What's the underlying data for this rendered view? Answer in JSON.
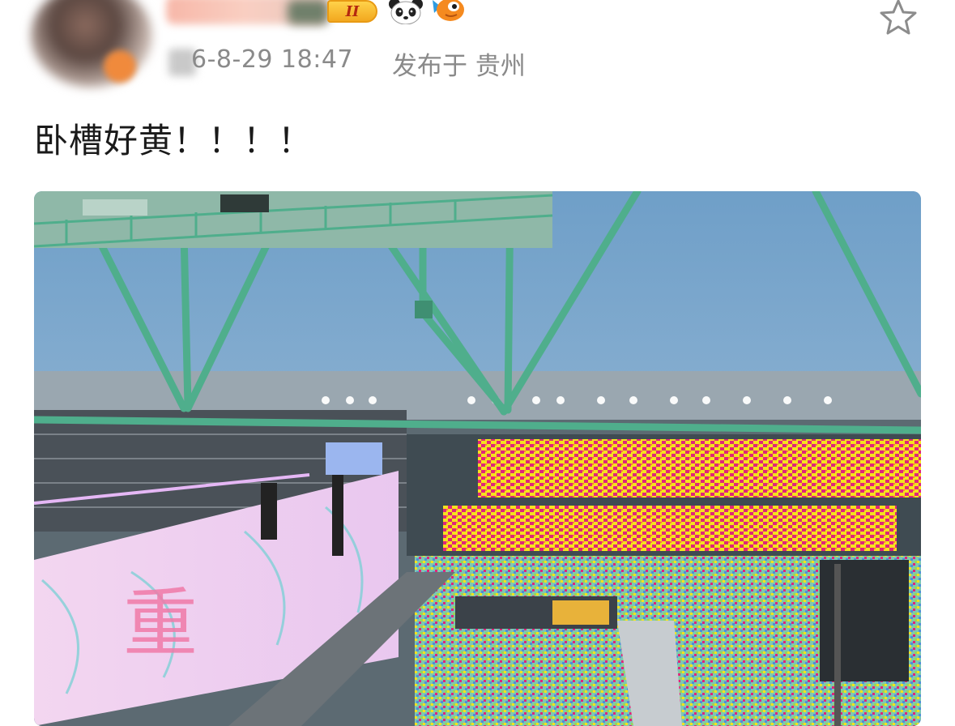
{
  "post": {
    "username": "",
    "level_badge": "II",
    "timestamp": "6-8-29 18:47",
    "location": "发布于 贵州",
    "text": "卧槽好黄！！！！"
  },
  "icons": {
    "avatar": "user-avatar",
    "level": "level-badge",
    "panda": "panda-emoji-icon",
    "fish": "fish-emoji-icon",
    "favorite": "star-icon"
  },
  "photo": {
    "subject": "stadium-concert-photo",
    "screen_text": "重"
  },
  "colors": {
    "text": "#1a1a1a",
    "meta": "#8a8a8a",
    "badge": "#f2a81f",
    "lightstick_yellow": "#f5e21e",
    "lightstick_magenta": "#e0257a"
  }
}
